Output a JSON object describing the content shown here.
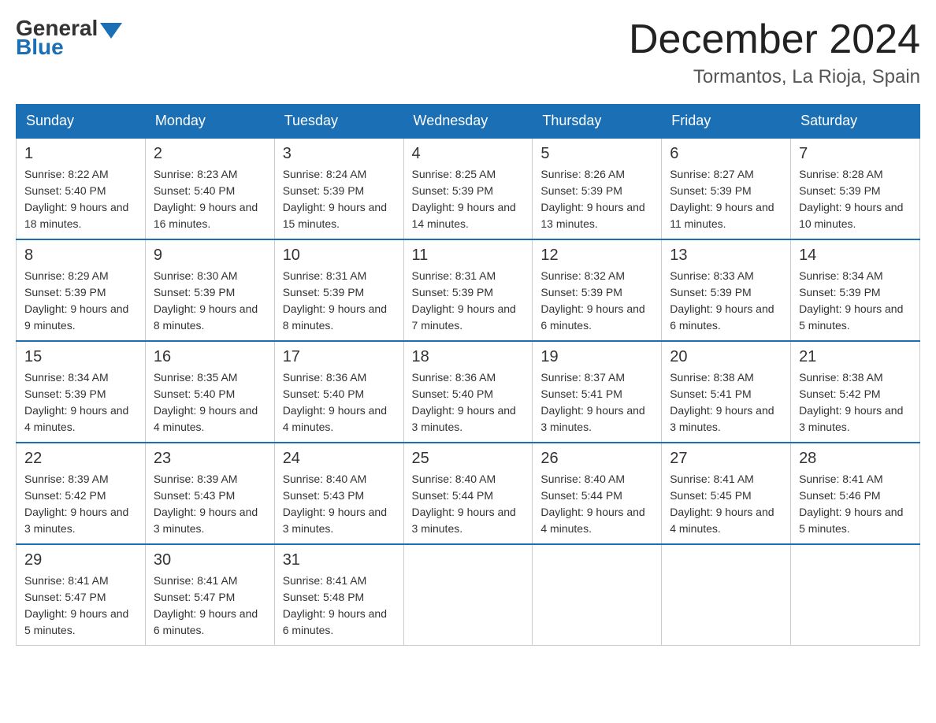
{
  "logo": {
    "general": "General",
    "blue": "Blue"
  },
  "header": {
    "month_year": "December 2024",
    "location": "Tormantos, La Rioja, Spain"
  },
  "weekdays": [
    "Sunday",
    "Monday",
    "Tuesday",
    "Wednesday",
    "Thursday",
    "Friday",
    "Saturday"
  ],
  "weeks": [
    [
      {
        "day": "1",
        "sunrise": "8:22 AM",
        "sunset": "5:40 PM",
        "daylight": "9 hours and 18 minutes."
      },
      {
        "day": "2",
        "sunrise": "8:23 AM",
        "sunset": "5:40 PM",
        "daylight": "9 hours and 16 minutes."
      },
      {
        "day": "3",
        "sunrise": "8:24 AM",
        "sunset": "5:39 PM",
        "daylight": "9 hours and 15 minutes."
      },
      {
        "day": "4",
        "sunrise": "8:25 AM",
        "sunset": "5:39 PM",
        "daylight": "9 hours and 14 minutes."
      },
      {
        "day": "5",
        "sunrise": "8:26 AM",
        "sunset": "5:39 PM",
        "daylight": "9 hours and 13 minutes."
      },
      {
        "day": "6",
        "sunrise": "8:27 AM",
        "sunset": "5:39 PM",
        "daylight": "9 hours and 11 minutes."
      },
      {
        "day": "7",
        "sunrise": "8:28 AM",
        "sunset": "5:39 PM",
        "daylight": "9 hours and 10 minutes."
      }
    ],
    [
      {
        "day": "8",
        "sunrise": "8:29 AM",
        "sunset": "5:39 PM",
        "daylight": "9 hours and 9 minutes."
      },
      {
        "day": "9",
        "sunrise": "8:30 AM",
        "sunset": "5:39 PM",
        "daylight": "9 hours and 8 minutes."
      },
      {
        "day": "10",
        "sunrise": "8:31 AM",
        "sunset": "5:39 PM",
        "daylight": "9 hours and 8 minutes."
      },
      {
        "day": "11",
        "sunrise": "8:31 AM",
        "sunset": "5:39 PM",
        "daylight": "9 hours and 7 minutes."
      },
      {
        "day": "12",
        "sunrise": "8:32 AM",
        "sunset": "5:39 PM",
        "daylight": "9 hours and 6 minutes."
      },
      {
        "day": "13",
        "sunrise": "8:33 AM",
        "sunset": "5:39 PM",
        "daylight": "9 hours and 6 minutes."
      },
      {
        "day": "14",
        "sunrise": "8:34 AM",
        "sunset": "5:39 PM",
        "daylight": "9 hours and 5 minutes."
      }
    ],
    [
      {
        "day": "15",
        "sunrise": "8:34 AM",
        "sunset": "5:39 PM",
        "daylight": "9 hours and 4 minutes."
      },
      {
        "day": "16",
        "sunrise": "8:35 AM",
        "sunset": "5:40 PM",
        "daylight": "9 hours and 4 minutes."
      },
      {
        "day": "17",
        "sunrise": "8:36 AM",
        "sunset": "5:40 PM",
        "daylight": "9 hours and 4 minutes."
      },
      {
        "day": "18",
        "sunrise": "8:36 AM",
        "sunset": "5:40 PM",
        "daylight": "9 hours and 3 minutes."
      },
      {
        "day": "19",
        "sunrise": "8:37 AM",
        "sunset": "5:41 PM",
        "daylight": "9 hours and 3 minutes."
      },
      {
        "day": "20",
        "sunrise": "8:38 AM",
        "sunset": "5:41 PM",
        "daylight": "9 hours and 3 minutes."
      },
      {
        "day": "21",
        "sunrise": "8:38 AM",
        "sunset": "5:42 PM",
        "daylight": "9 hours and 3 minutes."
      }
    ],
    [
      {
        "day": "22",
        "sunrise": "8:39 AM",
        "sunset": "5:42 PM",
        "daylight": "9 hours and 3 minutes."
      },
      {
        "day": "23",
        "sunrise": "8:39 AM",
        "sunset": "5:43 PM",
        "daylight": "9 hours and 3 minutes."
      },
      {
        "day": "24",
        "sunrise": "8:40 AM",
        "sunset": "5:43 PM",
        "daylight": "9 hours and 3 minutes."
      },
      {
        "day": "25",
        "sunrise": "8:40 AM",
        "sunset": "5:44 PM",
        "daylight": "9 hours and 3 minutes."
      },
      {
        "day": "26",
        "sunrise": "8:40 AM",
        "sunset": "5:44 PM",
        "daylight": "9 hours and 4 minutes."
      },
      {
        "day": "27",
        "sunrise": "8:41 AM",
        "sunset": "5:45 PM",
        "daylight": "9 hours and 4 minutes."
      },
      {
        "day": "28",
        "sunrise": "8:41 AM",
        "sunset": "5:46 PM",
        "daylight": "9 hours and 5 minutes."
      }
    ],
    [
      {
        "day": "29",
        "sunrise": "8:41 AM",
        "sunset": "5:47 PM",
        "daylight": "9 hours and 5 minutes."
      },
      {
        "day": "30",
        "sunrise": "8:41 AM",
        "sunset": "5:47 PM",
        "daylight": "9 hours and 6 minutes."
      },
      {
        "day": "31",
        "sunrise": "8:41 AM",
        "sunset": "5:48 PM",
        "daylight": "9 hours and 6 minutes."
      },
      null,
      null,
      null,
      null
    ]
  ],
  "labels": {
    "sunrise": "Sunrise:",
    "sunset": "Sunset:",
    "daylight": "Daylight:"
  }
}
